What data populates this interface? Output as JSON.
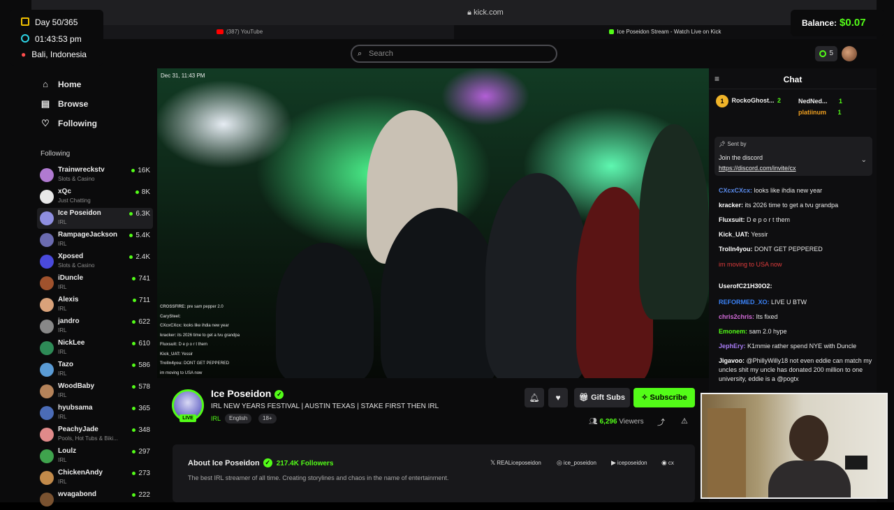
{
  "browser": {
    "url": "kick.com",
    "tabs": [
      {
        "label": "(387) YouTube"
      },
      {
        "label": "Ice Poseidon Stream - Watch Live on Kick"
      }
    ]
  },
  "header": {
    "search_placeholder": "Search",
    "notification_count": "5"
  },
  "sidebar": {
    "nav": [
      {
        "label": "Home",
        "icon": "home-icon"
      },
      {
        "label": "Browse",
        "icon": "browse-icon"
      },
      {
        "label": "Following",
        "icon": "heart-icon"
      }
    ],
    "following_title": "Following",
    "following": [
      {
        "name": "Trainwreckstv",
        "category": "Slots & Casino",
        "viewers": "16K",
        "color": "#b07ad1"
      },
      {
        "name": "xQc",
        "category": "Just Chatting",
        "viewers": "8K",
        "color": "#e8e8e8"
      },
      {
        "name": "Ice Poseidon",
        "category": "IRL",
        "viewers": "6.3K",
        "color": "#8f8fe0"
      },
      {
        "name": "RampageJackson",
        "category": "IRL",
        "viewers": "5.4K",
        "color": "#6b6bb0"
      },
      {
        "name": "Xposed",
        "category": "Slots & Casino",
        "viewers": "2.4K",
        "color": "#4a4adc"
      },
      {
        "name": "iDuncle",
        "category": "IRL",
        "viewers": "741",
        "color": "#a0522d"
      },
      {
        "name": "Alexis",
        "category": "IRL",
        "viewers": "711",
        "color": "#d9a27a"
      },
      {
        "name": "jandro",
        "category": "IRL",
        "viewers": "622",
        "color": "#888888"
      },
      {
        "name": "NickLee",
        "category": "IRL",
        "viewers": "610",
        "color": "#2e8b57"
      },
      {
        "name": "Tazo",
        "category": "IRL",
        "viewers": "586",
        "color": "#5a9bd5"
      },
      {
        "name": "WoodBaby",
        "category": "IRL",
        "viewers": "578",
        "color": "#b5835a"
      },
      {
        "name": "hyubsama",
        "category": "IRL",
        "viewers": "365",
        "color": "#4b6cb7"
      },
      {
        "name": "PeachyJade",
        "category": "Pools, Hot Tubs & Biki...",
        "viewers": "348",
        "color": "#e08a8a"
      },
      {
        "name": "Loulz",
        "category": "IRL",
        "viewers": "297",
        "color": "#3fa34d"
      },
      {
        "name": "ChickenAndy",
        "category": "IRL",
        "viewers": "273",
        "color": "#c28a4a"
      },
      {
        "name": "wvagabond",
        "category": "",
        "viewers": "222",
        "color": "#7a5230"
      }
    ]
  },
  "video": {
    "timestamp": "Dec 31, 11:43 PM",
    "overlay_chat": [
      {
        "user": "CROSSFIRE:",
        "text": "pre sam pepper 2.0"
      },
      {
        "user": "CarySteel:",
        "text": ""
      },
      {
        "user": "CXcxCXcx:",
        "text": "looks like ihdia new year"
      },
      {
        "user": "kracker:",
        "text": "its 2026 time to get a tvu grandpa"
      },
      {
        "user": "Fluxsuit:",
        "text": "D e p o r t them"
      },
      {
        "user": "Kick_UAT:",
        "text": "Yessir"
      },
      {
        "user": "Trolln4you:",
        "text": "DONT GET PEPPERED"
      },
      {
        "user": "",
        "text": "im moving to USA now"
      }
    ]
  },
  "stream": {
    "name": "Ice Poseidon",
    "live_label": "LIVE",
    "title": "IRL NEW YEARS FESTIVAL | AUSTIN TEXAS | STAKE FIRST THEN IRL",
    "category": "IRL",
    "tags": [
      "English",
      "18+"
    ],
    "gift_label": "Gift Subs",
    "subscribe_label": "Subscribe",
    "viewers_count": "6,296",
    "viewers_label": "Viewers",
    "about_title": "About Ice Poseidon",
    "followers": "217.4K Followers",
    "description": "The best IRL streamer of all time. Creating storylines and chaos in the name of entertainment.",
    "socials": [
      {
        "icon": "x-icon",
        "label": "REALiceposeidon"
      },
      {
        "icon": "instagram-icon",
        "label": "ice_poseidon"
      },
      {
        "icon": "youtube-icon",
        "label": "iceposeidon"
      },
      {
        "icon": "discord-icon",
        "label": "cx"
      }
    ]
  },
  "chat": {
    "title": "Chat",
    "leaderboard": [
      {
        "rank": "1",
        "name": "RockoGhost...",
        "count": "2"
      },
      {
        "name": "NedNed...",
        "count": "1"
      },
      {
        "name": "platiinum",
        "count": "1"
      }
    ],
    "pinned": {
      "sent_by": "Sent by",
      "message": "Join the discord",
      "link": "https://discord.com/invite/cx"
    },
    "messages": [
      {
        "user": "CXcxCXcx:",
        "text": "looks like ihdia new year",
        "color": "#5b8def"
      },
      {
        "user": "kracker:",
        "text": "its 2026 time to get a tvu grandpa",
        "color": "#ffffff"
      },
      {
        "user": "Fluxsuit:",
        "text": "D e p o r t them",
        "color": "#ffffff"
      },
      {
        "user": "Kick_UAT:",
        "text": "Yessir",
        "color": "#ffffff"
      },
      {
        "user": "Trolln4you:",
        "text": "DONT GET PEPPERED",
        "color": "#ffffff"
      },
      {
        "user": "",
        "text": "im moving to USA now",
        "color": "#e23c3c"
      },
      {
        "user": "UserofC21H30O2:",
        "text": "",
        "color": "#ffffff"
      },
      {
        "user": "REFORMED_XO:",
        "text": "LIVE U BTW",
        "color": "#3b82f6"
      },
      {
        "user": "chris2chris:",
        "text": "Its fixed",
        "color": "#d36bd9"
      },
      {
        "user": "Emonem:",
        "text": "sam 2.0 hype",
        "color": "#53fc18"
      },
      {
        "user": "JephEry:",
        "text": "K1mmie rather spend NYE with Duncle",
        "color": "#a77bf3"
      },
      {
        "user": "Jigavoo:",
        "text": "@PhillyWilly18 not even eddie can match my uncles shit my uncle has donated 200 million to one university, eddie is a @pogtx",
        "color": "#ffffff"
      }
    ]
  },
  "overlay": {
    "day": "Day 50/365",
    "time": "01:43:53 pm",
    "location": "Bali, Indonesia",
    "balance_label": "Balance:",
    "balance_value": "$0.07"
  }
}
